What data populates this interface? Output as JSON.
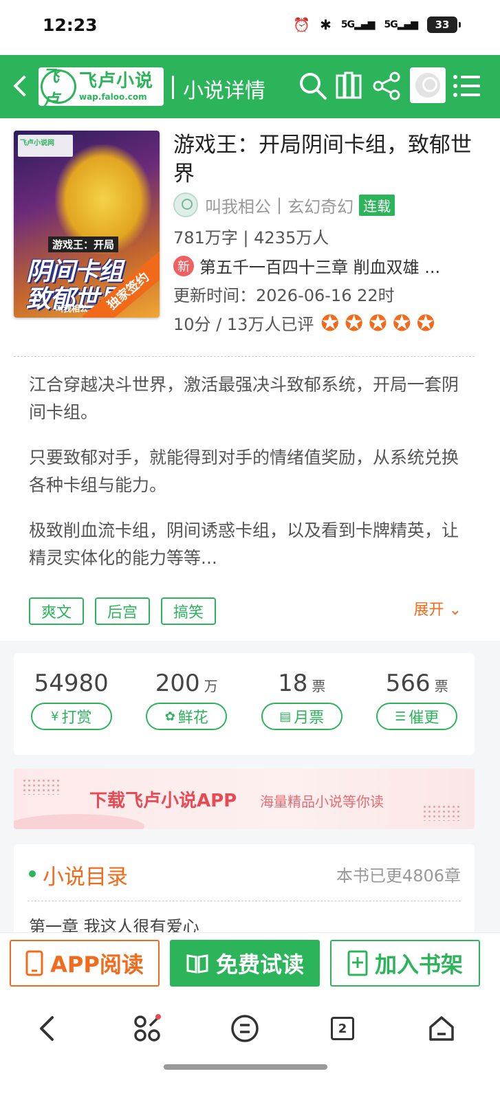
{
  "status": {
    "time": "12:23",
    "battery": "33",
    "signal1": "5G",
    "signal2": "5G"
  },
  "header": {
    "logo_name": "飞卢小说",
    "logo_url": "wap.faloo.com",
    "logo_mark": "飞卢",
    "title": "小说详情"
  },
  "book": {
    "cover": {
      "site": "飞卢小说网",
      "subtitle": "游戏王：开局",
      "big1": "阴间卡组",
      "big2": "致郁世界",
      "author": "叫我相公",
      "ribbon": "独家签约"
    },
    "title": "游戏王：开局阴间卡组，致郁世界",
    "author": "叫我相公",
    "genre": "玄幻奇幻",
    "status_tag": "连载",
    "stats": "781万字 | 4235万人",
    "new_badge": "新",
    "latest_chapter": "第五千一百四十三章 削血双雄 ...",
    "update_time": "更新时间：2026-06-16 22时",
    "rating": "10分 / 13万人已评",
    "stars": 5,
    "intro": [
      "江合穿越决斗世界，激活最强决斗致郁系统，开局一套阴间卡组。",
      "只要致郁对手，就能得到对手的情绪值奖励，从系统兑换各种卡组与能力。",
      "极致削血流卡组，阴间诱惑卡组，以及看到卡牌精英，让精灵实体化的能力等等..."
    ],
    "tags": [
      "爽文",
      "后宫",
      "搞笑"
    ],
    "expand": "展开"
  },
  "support": [
    {
      "value": "54980",
      "unit": "",
      "label": "打赏",
      "icon": "¥"
    },
    {
      "value": "200",
      "unit": "万",
      "label": "鲜花",
      "icon": "✿"
    },
    {
      "value": "18",
      "unit": "票",
      "label": "月票",
      "icon": "▤"
    },
    {
      "value": "566",
      "unit": "票",
      "label": "催更",
      "icon": "☰"
    }
  ],
  "banner": {
    "main": "下载飞卢小说APP",
    "sub": "海量精品小说等你读"
  },
  "catalog": {
    "title": "小说目录",
    "count": "本书已更4806章",
    "first_chapter": "第一章 我这人很有爱心"
  },
  "actions": {
    "app": "APP阅读",
    "free": "免费试读",
    "shelf": "加入书架"
  },
  "sysnav": {
    "tabs_count": "2"
  },
  "colors": {
    "brand": "#2cb45b",
    "accent": "#f26b1d"
  }
}
